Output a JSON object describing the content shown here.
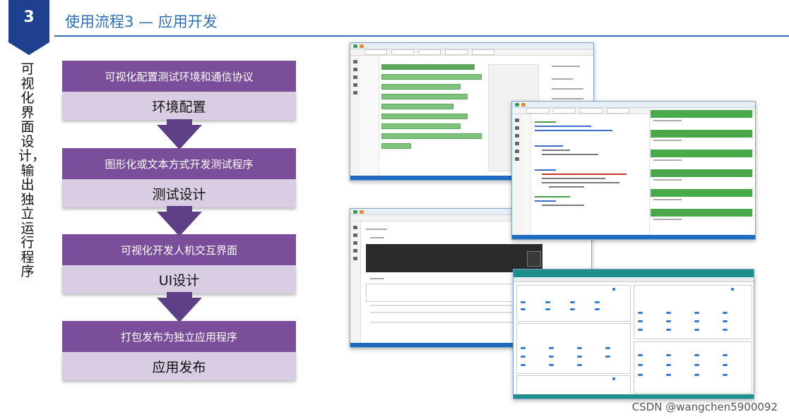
{
  "step_number": "3",
  "title": "使用流程3 — 应用开发",
  "side_text": "可视化界面设计，输出独立运行程序",
  "stages": [
    {
      "top": "可视化配置测试环境和通信协议",
      "bottom": "环境配置"
    },
    {
      "top": "图形化或文本方式开发测试程序",
      "bottom": "测试设计"
    },
    {
      "top": "可视化开发人机交互界面",
      "bottom": "UI设计"
    },
    {
      "top": "打包发布为独立应用程序",
      "bottom": "应用发布"
    }
  ],
  "watermark": "CSDN @wangchen5900092",
  "colors": {
    "accent": "#2f6fb6",
    "stage_top": "#7a4e9a",
    "stage_bottom": "#d8cde3",
    "arrow": "#5e3f85"
  }
}
